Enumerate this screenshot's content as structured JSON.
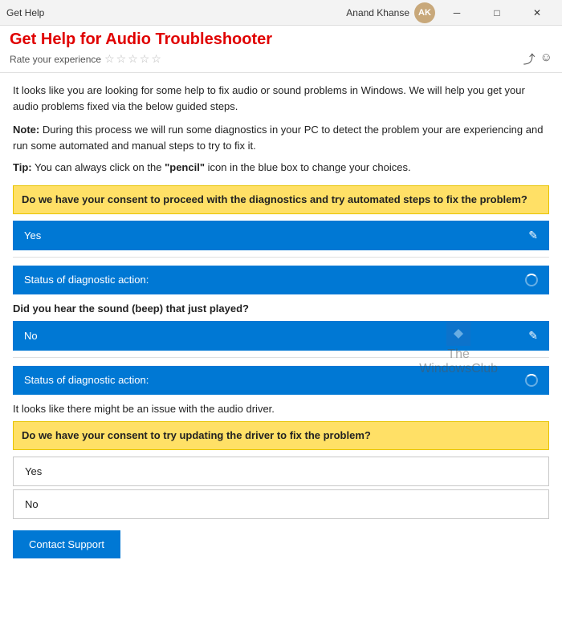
{
  "titlebar": {
    "menu_label": "Get Help",
    "user_name": "Anand Khanse",
    "avatar_initials": "AK",
    "min_btn": "─",
    "max_btn": "□",
    "close_btn": "✕"
  },
  "header": {
    "title": "Get Help for Audio Troubleshooter",
    "rating_label": "Rate your experience"
  },
  "content": {
    "intro": "It looks like you are looking for some help to fix audio or sound problems in Windows. We will help you get your audio problems fixed via the below guided steps.",
    "note_prefix": "Note:",
    "note_body": " During this process we will run some diagnostics in your PC to detect the problem your are experiencing and run some automated  and manual steps to try to fix it.",
    "tip_prefix": "Tip:",
    "tip_body": " You can always click on the ",
    "tip_pencil": "\"pencil\"",
    "tip_suffix": " icon in the blue box to change your choices.",
    "consent1_text": "Do we have your consent to proceed with the diagnostics and try automated steps to fix the problem?",
    "yes_answer1": "Yes",
    "status_label1": "Status of diagnostic action:",
    "beep_question": "Did you hear the sound (beep) that just played?",
    "no_answer": "No",
    "status_label2": "Status of diagnostic action:",
    "audio_issue_text": "It looks like there might be an issue with the audio driver.",
    "consent2_text": "Do we have your consent to try updating the driver to fix the problem?",
    "yes_answer2": "Yes",
    "no_answer2": "No",
    "contact_support_label": "Contact Support"
  },
  "colors": {
    "blue": "#0078d4",
    "yellow": "#ffe066",
    "red_title": "#e00000"
  },
  "icons": {
    "pencil": "✎",
    "star_empty": "☆",
    "share": "⤴",
    "feedback": "☺"
  }
}
